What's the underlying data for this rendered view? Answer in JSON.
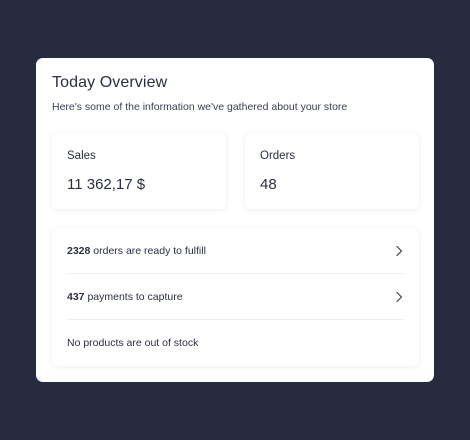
{
  "overview": {
    "title": "Today Overview",
    "subtitle": "Here's some of the information we've gathered about your store"
  },
  "stats": {
    "sales": {
      "label": "Sales",
      "value": "11 362,17 $"
    },
    "orders": {
      "label": "Orders",
      "value": "48"
    }
  },
  "tasks": {
    "fulfill": {
      "count": "2328",
      "text": " orders are ready to fulfill"
    },
    "capture": {
      "count": "437",
      "text": " payments to capture"
    },
    "stock": {
      "text": "No products are out of stock"
    }
  },
  "icons": {
    "row_action": "chevron-right-icon"
  },
  "colors": {
    "background": "#272b3f",
    "card": "#ffffff",
    "text": "#2a3042"
  }
}
